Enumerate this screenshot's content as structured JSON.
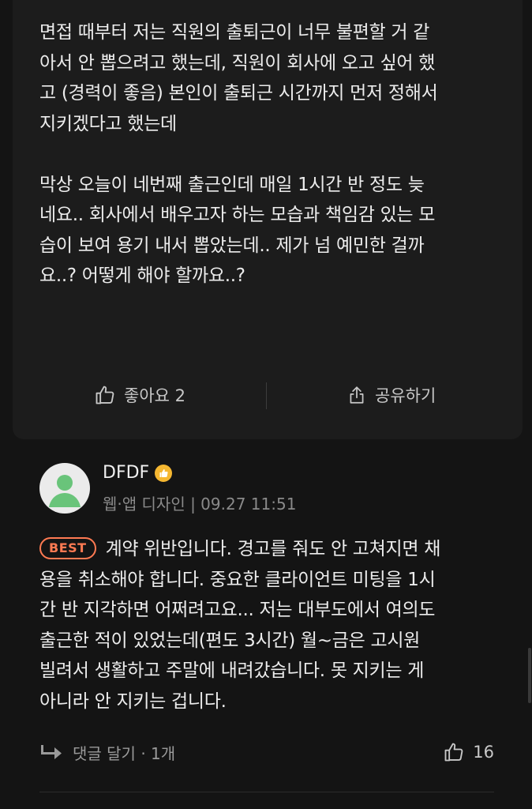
{
  "post": {
    "paragraphs": [
      "면접 때부터 저는 직원의 출퇴근이 너무 불편할 거 같\n아서 안 뽑으려고 했는데, 직원이 회사에 오고 싶어 했\n고 (경력이 좋음) 본인이 출퇴근 시간까지 먼저 정해서\n지키겠다고 했는데",
      "막상 오늘이 네번째 출근인데 매일 1시간 반 정도 늦\n네요.. 회사에서 배우고자 하는 모습과 책임감 있는 모\n습이 보여 용기 내서 뽑았는데.. 제가 넘 예민한 걸까\n요..? 어떻게 해야 할까요..?"
    ],
    "like_label": "좋아요 2",
    "share_label": "공유하기"
  },
  "comment": {
    "author": "DFDF",
    "meta": "웹·앱 디자인 | 09.27 11:51",
    "best_label": "BEST",
    "text": "계약 위반입니다. 경고를 줘도 안 고쳐지면 채\n용을 취소해야 합니다. 중요한 클라이언트 미팅을 1시\n간 반 지각하면 어쩌려고요... 저는 대부도에서 여의도\n출근한 적이 있었는데(편도 3시간) 월~금은 고시원\n빌려서 생활하고 주말에 내려갔습니다. 못 지키는 게\n아니라 안 지키는 겁니다.",
    "reply_label": "댓글 달기 · 1개",
    "like_count": "16"
  },
  "colors": {
    "background": "#141414",
    "card": "#1c1c1c",
    "best_accent": "#ff7a52",
    "avatar_green": "#69c47a",
    "badge_yellow": "#f5b731"
  },
  "icons": {
    "like": "thumbs-up-icon",
    "share": "share-icon",
    "reply": "reply-arrow-icon",
    "badge": "thumbs-up-badge-icon"
  }
}
